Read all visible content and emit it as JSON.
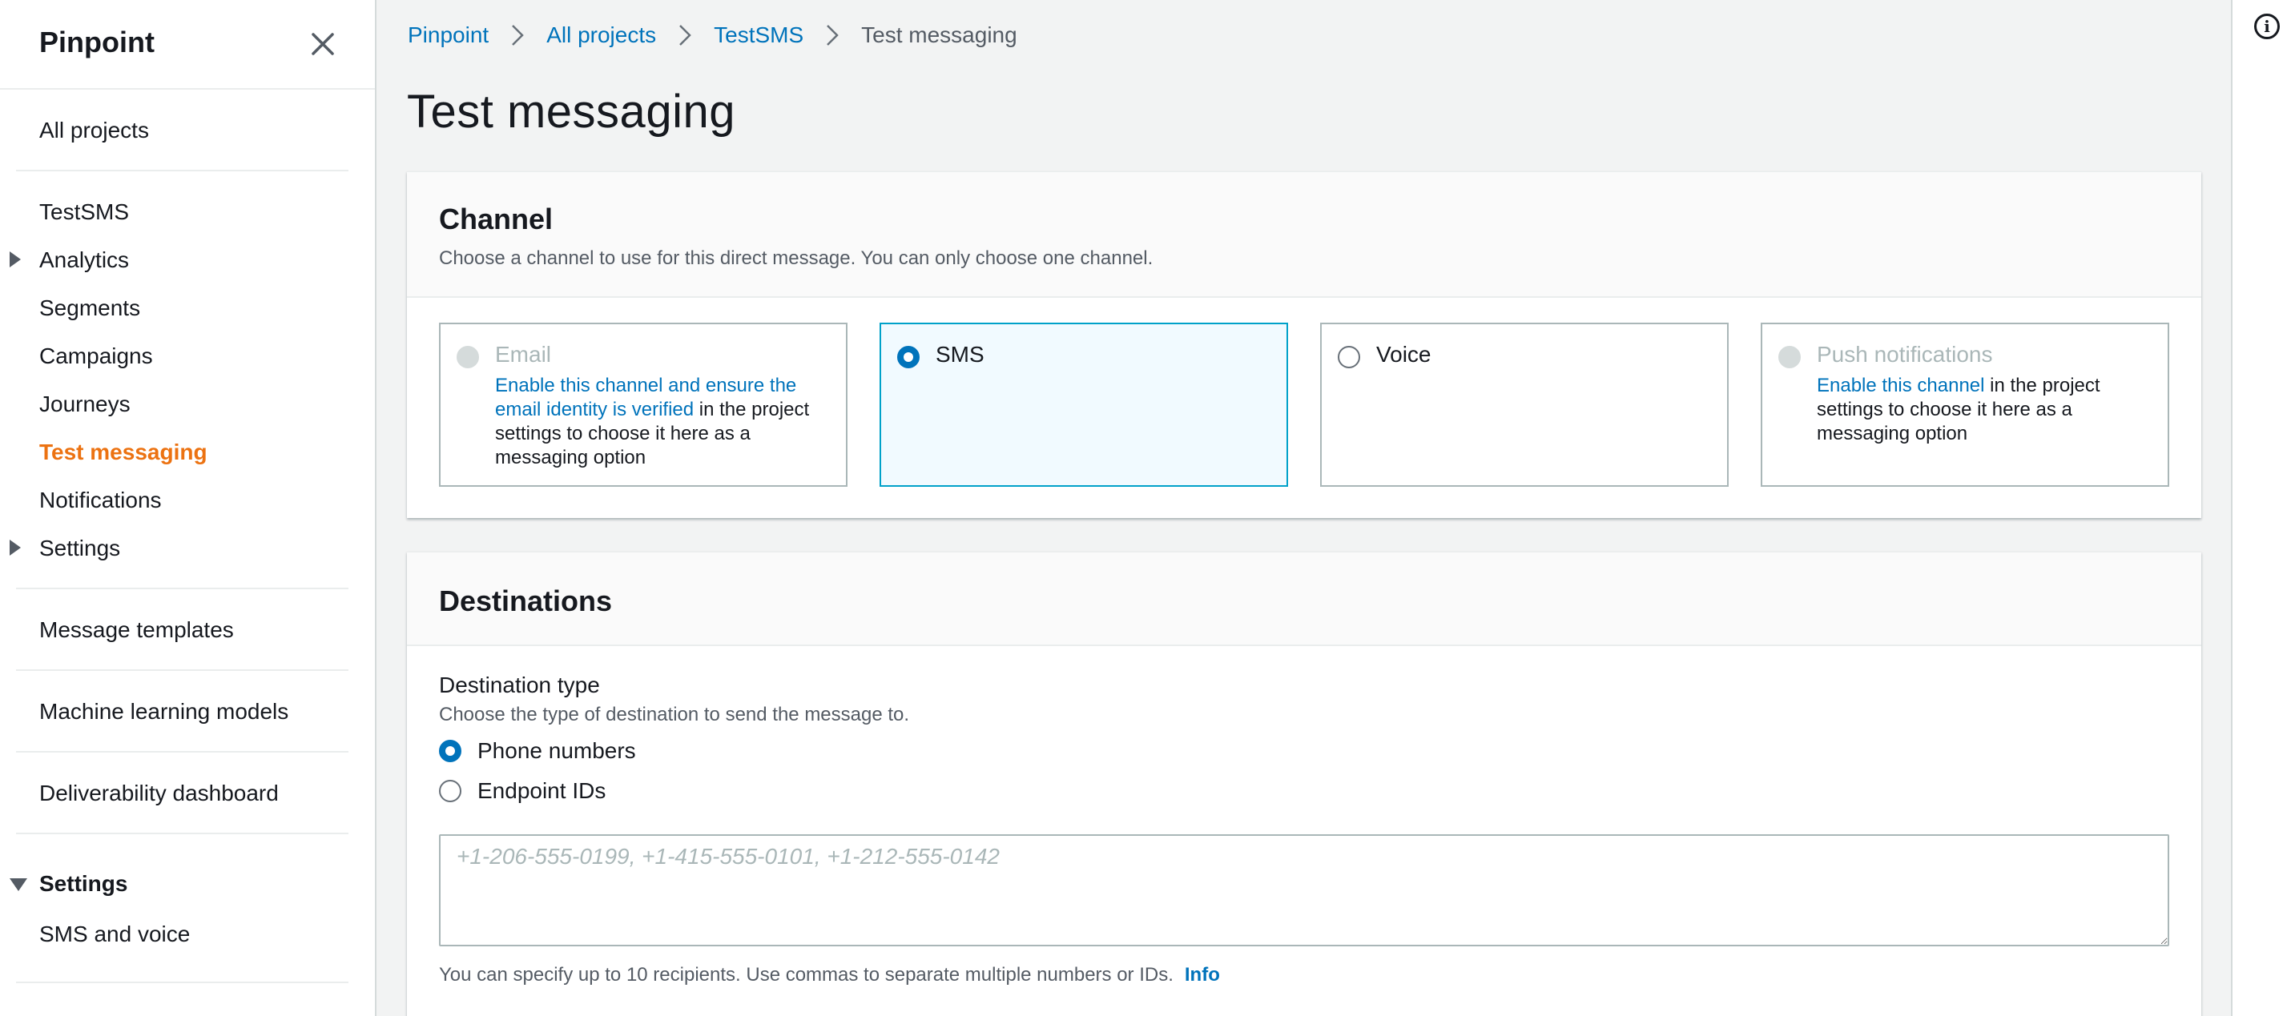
{
  "sidebar": {
    "title": "Pinpoint",
    "all_projects": "All projects",
    "project_name": "TestSMS",
    "nav": [
      {
        "label": "Analytics"
      },
      {
        "label": "Segments"
      },
      {
        "label": "Campaigns"
      },
      {
        "label": "Journeys"
      },
      {
        "label": "Test messaging"
      },
      {
        "label": "Notifications"
      },
      {
        "label": "Settings"
      }
    ],
    "message_templates": "Message templates",
    "ml_models": "Machine learning models",
    "deliverability": "Deliverability dashboard",
    "settings_section": "Settings",
    "sms_voice": "SMS and voice"
  },
  "breadcrumb": {
    "items": [
      "Pinpoint",
      "All projects",
      "TestSMS",
      "Test messaging"
    ]
  },
  "page": {
    "title": "Test messaging"
  },
  "channel": {
    "title": "Channel",
    "description": "Choose a channel to use for this direct message. You can only choose one channel.",
    "email": {
      "label": "Email",
      "link": "Enable this channel and ensure the email identity is verified",
      "rest": " in the project settings to choose it here as a messaging option"
    },
    "sms": {
      "label": "SMS"
    },
    "voice": {
      "label": "Voice"
    },
    "push": {
      "label": "Push notifications",
      "link": "Enable this channel",
      "rest": " in the project settings to choose it here as a messaging option"
    }
  },
  "destinations": {
    "title": "Destinations",
    "type_label": "Destination type",
    "type_desc": "Choose the type of destination to send the message to.",
    "opt_phone": "Phone numbers",
    "opt_endpoint": "Endpoint IDs",
    "placeholder": "+1-206-555-0199, +1-415-555-0101, +1-212-555-0142",
    "constraint": "You can specify up to 10 recipients. Use commas to separate multiple numbers or IDs.",
    "info": "Info"
  },
  "colors": {
    "accent_link": "#0073bb",
    "active_nav": "#ec7211",
    "selected_tile_border": "#00a1c9",
    "selected_tile_bg": "#f1faff"
  }
}
